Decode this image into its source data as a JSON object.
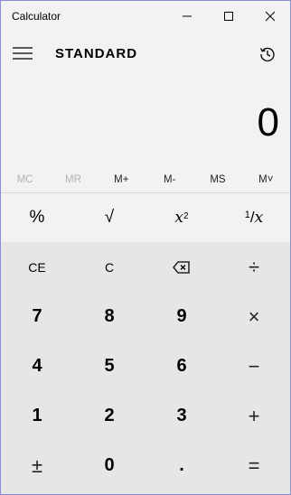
{
  "app": {
    "title": "Calculator",
    "mode": "STANDARD"
  },
  "display": {
    "value": "0"
  },
  "memory": [
    {
      "label": "MC",
      "enabled": false
    },
    {
      "label": "MR",
      "enabled": false
    },
    {
      "label": "M+",
      "enabled": true
    },
    {
      "label": "M-",
      "enabled": true
    },
    {
      "label": "MS",
      "enabled": true
    },
    {
      "label": "M˅",
      "enabled": true
    }
  ],
  "functions": {
    "percent": "%",
    "sqrt": "√",
    "square_base": "x",
    "square_exp": "2",
    "reciprocal_num": "1",
    "reciprocal_den": "x"
  },
  "keys": {
    "ce": "CE",
    "c": "C",
    "divide": "÷",
    "seven": "7",
    "eight": "8",
    "nine": "9",
    "multiply": "×",
    "four": "4",
    "five": "5",
    "six": "6",
    "subtract": "−",
    "one": "1",
    "two": "2",
    "three": "3",
    "add": "+",
    "negate": "±",
    "zero": "0",
    "decimal": ".",
    "equals": "="
  },
  "icons": {
    "minimize": "minimize-icon",
    "maximize": "maximize-icon",
    "close": "close-icon",
    "menu": "hamburger-icon",
    "history": "history-icon",
    "backspace": "backspace-icon"
  }
}
